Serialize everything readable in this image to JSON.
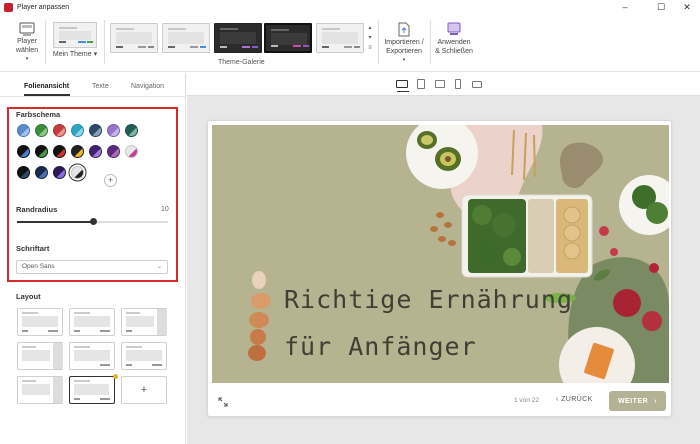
{
  "window": {
    "title": "Player anpassen",
    "min": "–",
    "max": "☐",
    "close": "✕"
  },
  "ribbon": {
    "player_label": "Player\nwählen",
    "my_theme_label": "Mein Theme",
    "gallery_label": "Theme-Galerie",
    "import_label": "Importieren /\nExportieren",
    "apply_label": "Anwenden\n& Schließen"
  },
  "left_panel": {
    "tabs": [
      "Folienansicht",
      "Texte",
      "Navigation"
    ],
    "active_tab": "Folienansicht",
    "color_scheme_heading": "Farbschema",
    "colors": [
      [
        "#5a8ccf",
        "#a7c2ea"
      ],
      [
        "#3c8c3c",
        "#8bc78b"
      ],
      [
        "#c63b3b",
        "#e59595"
      ],
      [
        "#2aa5c4",
        "#8ed6e8"
      ],
      [
        "#2f4a66",
        "#8aa0b8"
      ],
      [
        "#9575cd",
        "#c7b3ea"
      ],
      [
        "#1f5e52",
        "#7fb3a8"
      ],
      [
        "#111111",
        "#4a7cd6"
      ],
      [
        "#111111",
        "#43a047"
      ],
      [
        "#111111",
        "#d32f2f"
      ],
      [
        "#222222",
        "#f0b429"
      ],
      [
        "#3d2270",
        "#9b7ad8"
      ],
      [
        "#5a2a82",
        "#b06ab3"
      ],
      [
        "#e8e8e8",
        "#c2408f"
      ],
      [
        "#111111",
        "#2f4a66"
      ],
      [
        "#1c2a4a",
        "#4a6fb5"
      ],
      [
        "#2b1a55",
        "#8a6fe0"
      ],
      [
        "#e6e6e6",
        "#222222"
      ]
    ],
    "border_radius_label": "Randradius",
    "border_radius_value": "10",
    "border_radius_fraction": 0.5,
    "font_label": "Schriftart",
    "font_value": "Open Sans",
    "layout_heading": "Layout"
  },
  "slide": {
    "title_line1": "Richtige Ernährung",
    "title_line2": "für Anfänger",
    "bg": "#b6b490",
    "text_color": "#3f3f35"
  },
  "player_controls": {
    "page": "1 von 22",
    "back": "ZURÜCK",
    "next": "WEITER",
    "accent": "#b4b294"
  }
}
